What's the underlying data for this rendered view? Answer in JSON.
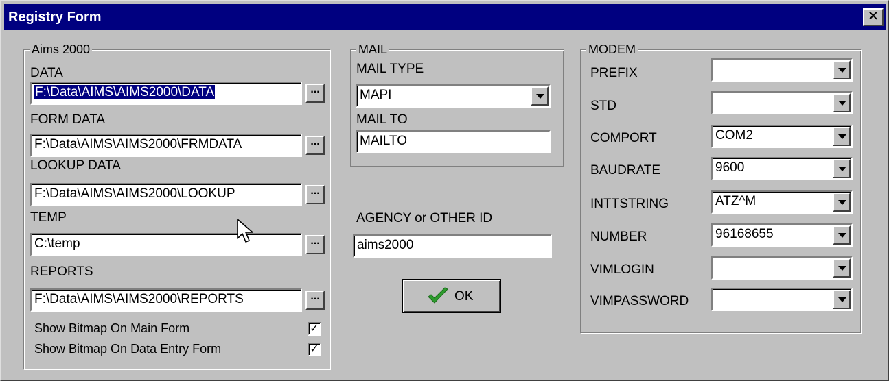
{
  "window": {
    "title": "Registry Form",
    "close_glyph": "✕"
  },
  "aims": {
    "legend": "Aims 2000",
    "data": {
      "label": "DATA",
      "value": "F:\\Data\\AIMS\\AIMS2000\\DATA"
    },
    "form_data": {
      "label": "FORM DATA",
      "value": "F:\\Data\\AIMS\\AIMS2000\\FRMDATA"
    },
    "lookup_data": {
      "label": "LOOKUP DATA",
      "value": "F:\\Data\\AIMS\\AIMS2000\\LOOKUP"
    },
    "temp": {
      "label": "TEMP",
      "value": "C:\\temp"
    },
    "reports": {
      "label": "REPORTS",
      "value": "F:\\Data\\AIMS\\AIMS2000\\REPORTS"
    },
    "browse_label": "...",
    "show_bitmap_main": {
      "label": "Show Bitmap On Main Form",
      "checked": true,
      "mark": "✓"
    },
    "show_bitmap_entry": {
      "label": "Show Bitmap On Data Entry Form",
      "checked": true,
      "mark": "✓"
    }
  },
  "mail": {
    "legend": "MAIL",
    "mail_type": {
      "label": "MAIL TYPE",
      "value": "MAPI"
    },
    "mail_to": {
      "label": "MAIL TO",
      "value": "MAILTO"
    }
  },
  "agency": {
    "label": "AGENCY or OTHER ID",
    "value": "aims2000"
  },
  "ok_button": {
    "label": "OK"
  },
  "modem": {
    "legend": "MODEM",
    "prefix": {
      "label": "PREFIX",
      "value": ""
    },
    "std": {
      "label": "STD",
      "value": ""
    },
    "comport": {
      "label": "COMPORT",
      "value": "COM2"
    },
    "baudrate": {
      "label": "BAUDRATE",
      "value": "9600"
    },
    "inttstring": {
      "label": "INTTSTRING",
      "value": "ATZ^M"
    },
    "number": {
      "label": "NUMBER",
      "value": "96168655"
    },
    "vimlogin": {
      "label": "VIMLOGIN",
      "value": ""
    },
    "vimpassword": {
      "label": "VIMPASSWORD",
      "value": ""
    }
  },
  "colors": {
    "titlebar": "#000080",
    "face": "#c0c0c0",
    "selection": "#000080",
    "check_green": "#2e9b2e"
  }
}
